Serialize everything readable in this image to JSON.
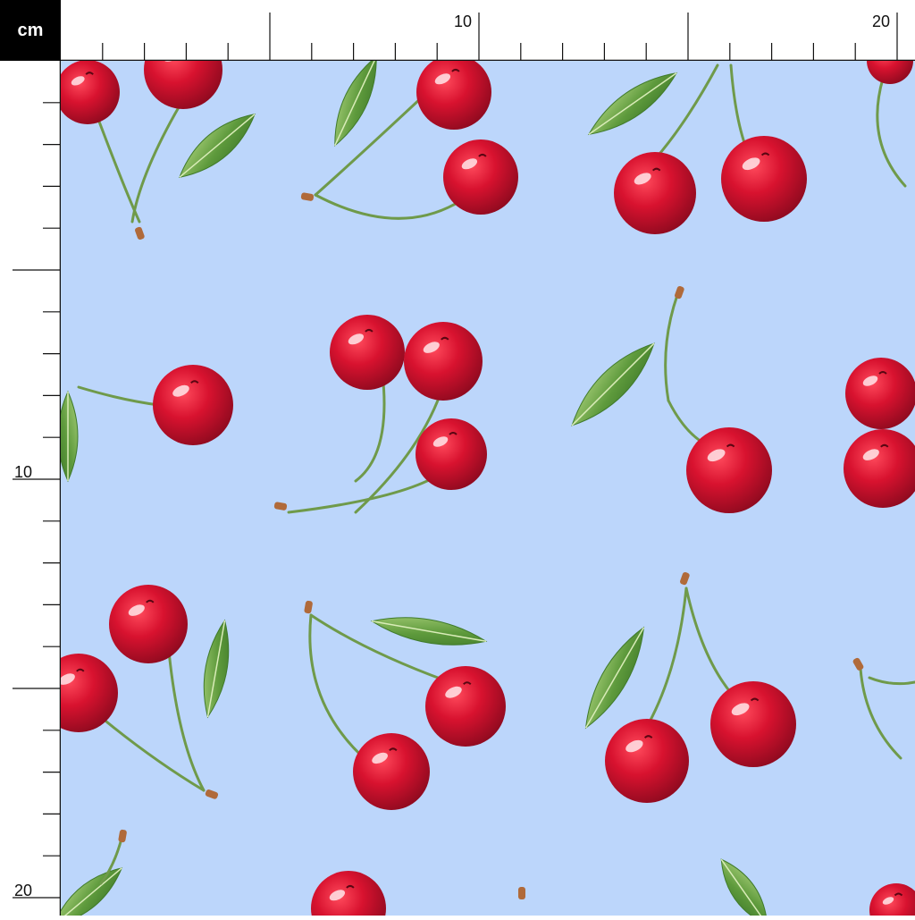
{
  "ruler": {
    "unit_label": "cm",
    "top_labels": [
      "10",
      "20"
    ],
    "left_labels": [
      "10",
      "20"
    ]
  },
  "colors": {
    "background": "#bcd6fb",
    "cherry": "#c8102e",
    "cherry_dark": "#8e0a1f",
    "leaf": "#5e9a3c",
    "stem": "#6f9a4a"
  }
}
